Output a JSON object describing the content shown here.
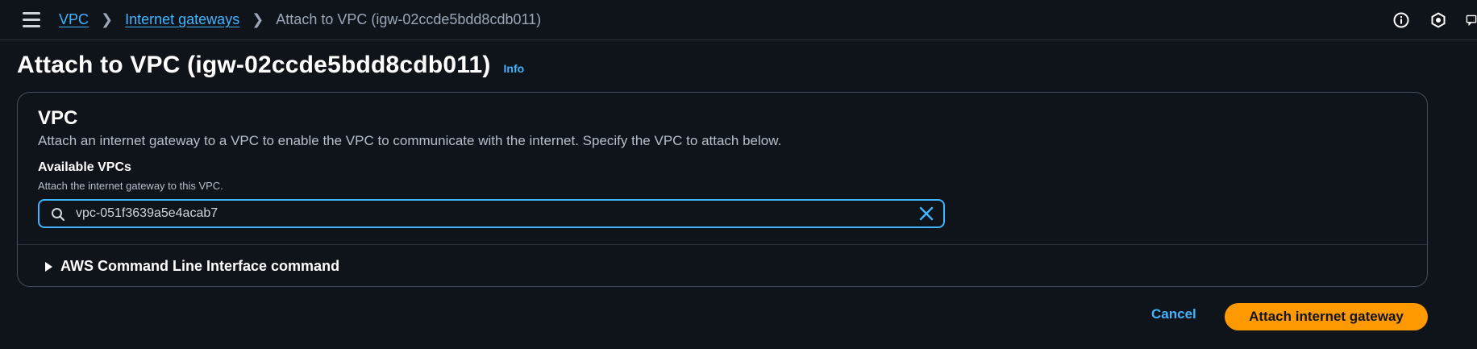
{
  "breadcrumb": {
    "items": [
      "VPC",
      "Internet gateways"
    ],
    "current": "Attach to VPC (igw-02ccde5bdd8cdb011)"
  },
  "top_icons": [
    "info-icon",
    "settings-hex-icon",
    "feedback-icon"
  ],
  "header": {
    "title": "Attach to VPC (igw-02ccde5bdd8cdb011)",
    "info_label": "Info"
  },
  "vpc_panel": {
    "title": "VPC",
    "description": "Attach an internet gateway to a VPC to enable the VPC to communicate with the internet. Specify the VPC to attach below.",
    "field_label": "Available VPCs",
    "field_hint": "Attach the internet gateway to this VPC.",
    "search_value": "vpc-051f3639a5e4acab7",
    "cli_expander_label": "AWS Command Line Interface command"
  },
  "actions": {
    "cancel_label": "Cancel",
    "submit_label": "Attach internet gateway"
  },
  "colors": {
    "background": "#0f141a",
    "link": "#42b4ff",
    "primary_button": "#ff9900",
    "border": "#414d5c"
  }
}
